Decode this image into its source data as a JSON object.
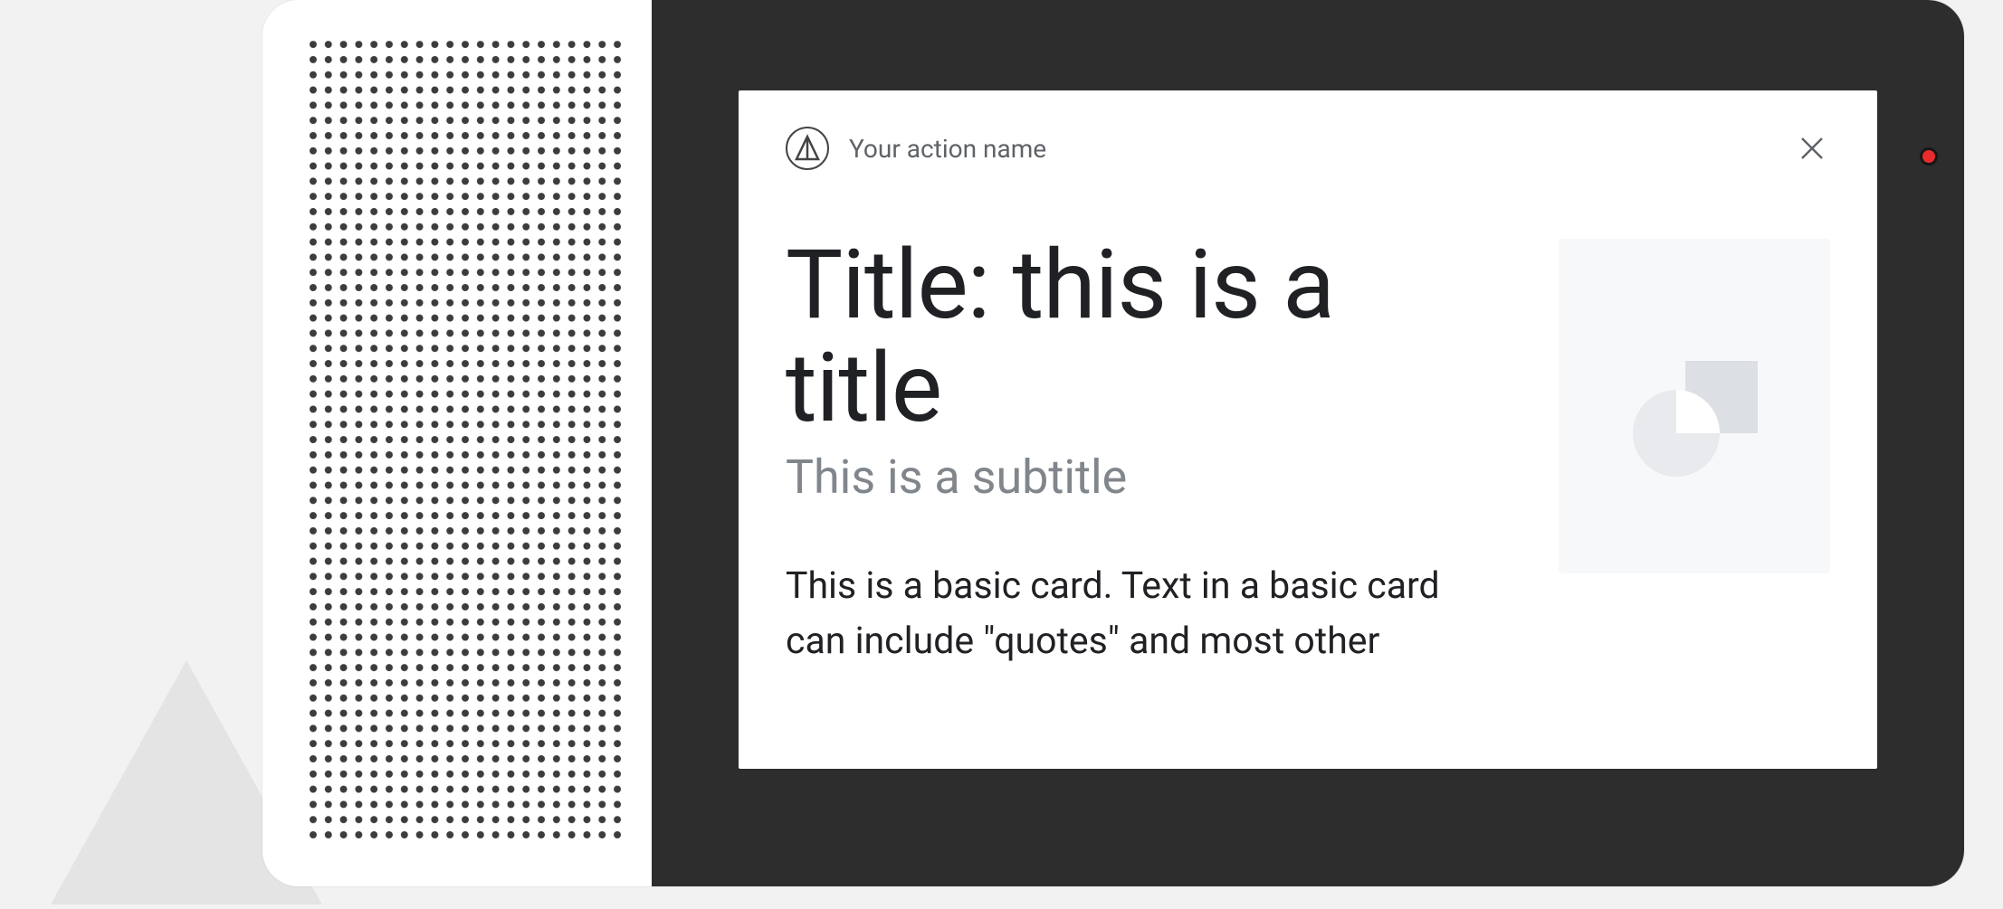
{
  "card": {
    "action_name": "Your action name",
    "title": "Title: this is a title",
    "subtitle": "This is a subtitle",
    "description": "This is a basic card. Text in a basic card can include \"quotes\" and most other"
  },
  "colors": {
    "led": "#ea2b2b",
    "screen_bg": "#2d2d2d",
    "text_primary": "#202124",
    "text_secondary": "#80868b"
  }
}
